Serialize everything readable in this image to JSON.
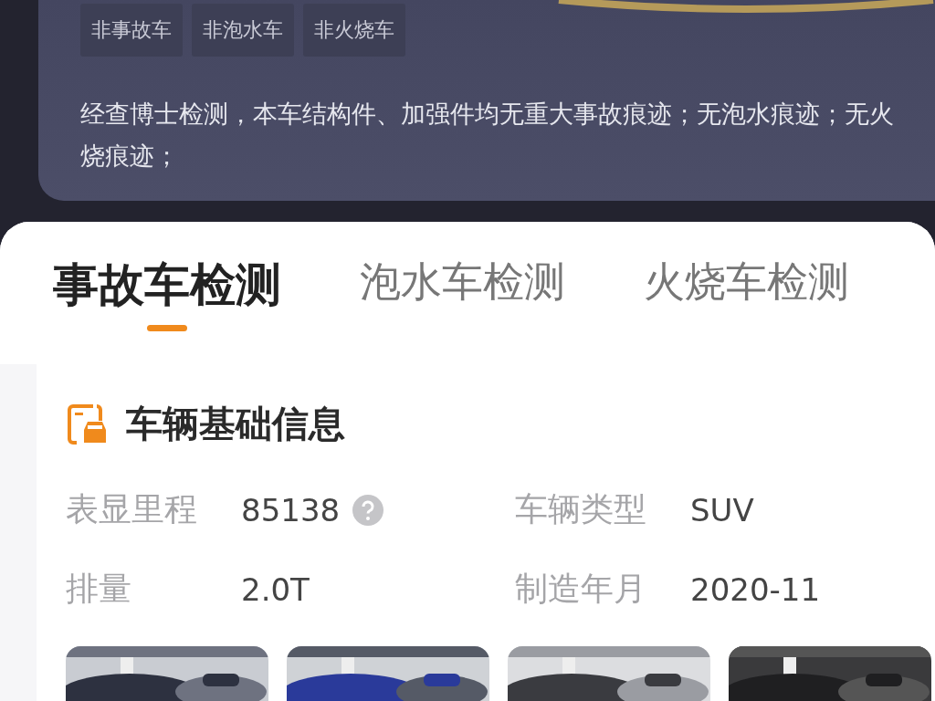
{
  "tags": [
    "非事故车",
    "非泡水车",
    "非火烧车"
  ],
  "summary": "经查博士检测，本车结构件、加强件均无重大事故痕迹；无泡水痕迹；无火烧痕迹；",
  "tabs": [
    {
      "label": "事故车检测",
      "selected": true
    },
    {
      "label": "泡水车检测",
      "selected": false
    },
    {
      "label": "火烧车检测",
      "selected": false
    }
  ],
  "card": {
    "title": "车辆基础信息",
    "fields": [
      {
        "label": "表显里程",
        "value": "85138",
        "help": true
      },
      {
        "label": "车辆类型",
        "value": "SUV",
        "help": false
      },
      {
        "label": "排量",
        "value": "2.0T",
        "help": false
      },
      {
        "label": "制造年月",
        "value": "2020-11",
        "help": false
      }
    ]
  }
}
